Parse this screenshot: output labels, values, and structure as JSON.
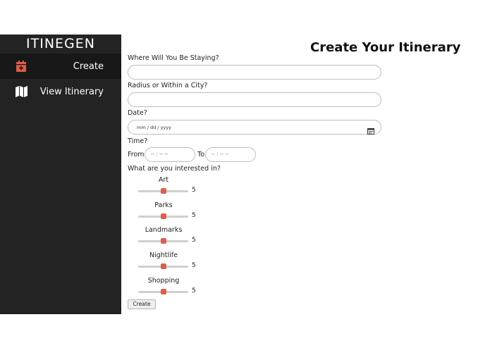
{
  "sidebar": {
    "brand": "ITINEGEN",
    "items": [
      {
        "label": "Create",
        "icon": "calendar-plus-icon",
        "active": true
      },
      {
        "label": "View Itinerary",
        "icon": "map-icon",
        "active": false
      }
    ]
  },
  "main": {
    "title": "Create Your Itinerary",
    "staying_label": "Where Will You Be Staying?",
    "staying_value": "",
    "radius_label": "Radius or Within a City?",
    "radius_value": "",
    "date_label": "Date?",
    "date_placeholder": "mm / dd / yyyy",
    "time_label": "Time?",
    "time_from_label": "From",
    "time_from_placeholder": "-- : --  --",
    "time_to_label": "To",
    "time_to_placeholder": "-- : --  --",
    "interests_label": "What are you interested in?",
    "interests": [
      {
        "name": "Art",
        "value": "5"
      },
      {
        "name": "Parks",
        "value": "5"
      },
      {
        "name": "Landmarks",
        "value": "5"
      },
      {
        "name": "Nightlife",
        "value": "5"
      },
      {
        "name": "Shopping",
        "value": "5"
      }
    ],
    "slider_min": 0,
    "slider_max": 10,
    "create_button": "Create"
  },
  "colors": {
    "sidebar_bg": "#232323",
    "active_item_bg": "#181818",
    "accent": "#e05d48"
  }
}
